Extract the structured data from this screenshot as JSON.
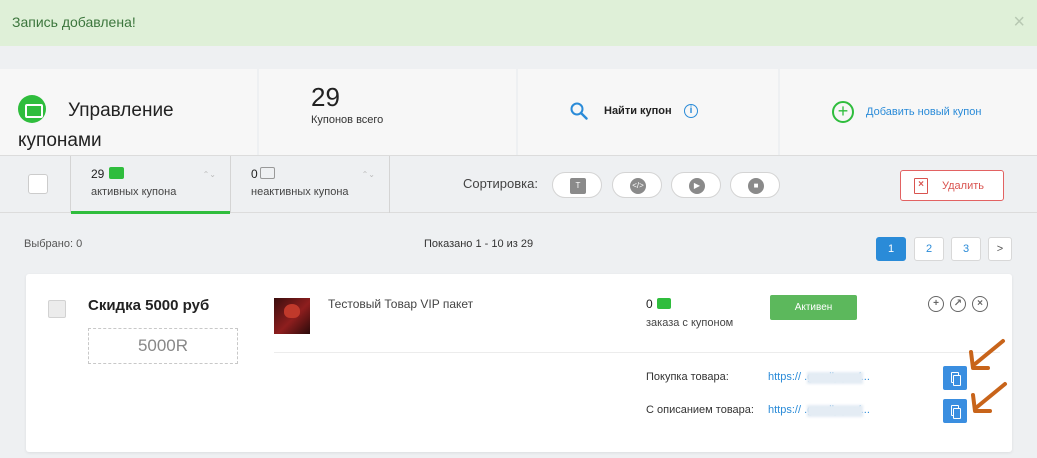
{
  "alert": {
    "message": "Запись добавлена!",
    "close": "×"
  },
  "stats": {
    "title": "Управление купонами",
    "total_value": "29",
    "total_label": "Купонов всего",
    "find_label": "Найти купон",
    "info_glyph": "i",
    "add_label": "Добавить новый купон",
    "add_glyph": "+"
  },
  "tabs": [
    {
      "count": "29",
      "label": "активных купона"
    },
    {
      "count": "0",
      "label": "неактивных купона"
    }
  ],
  "tab_sort_glyph": "⌃⌄",
  "sort": {
    "label": "Сортировка:",
    "glyphs": [
      "T",
      "</>",
      "▶",
      "■"
    ]
  },
  "delete_label": "Удалить",
  "delete_glyph": "×",
  "selected": "Выбрано: 0",
  "shown": "Показано 1 - 10 из 29",
  "pagination": [
    "1",
    "2",
    "3",
    ">"
  ],
  "coupon": {
    "name": "Скидка 5000 руб",
    "code": "5000R",
    "product": "Тестовый Товар VIP пакет",
    "orders_count": "0",
    "orders_label": "заказа с купоном",
    "status": "Активен",
    "action_glyphs": [
      "+",
      "↗",
      "×"
    ],
    "links": [
      {
        "label": "Покупка товара:",
        "url": "https://           .goodly.pro/..."
      },
      {
        "label": "С описанием товара:",
        "url": "https://           .goodly.pro/..."
      }
    ]
  },
  "colors": {
    "green": "#2fbd3d",
    "blue": "#2a8bd8",
    "red": "#d9534f",
    "arrow": "#c8641a"
  }
}
